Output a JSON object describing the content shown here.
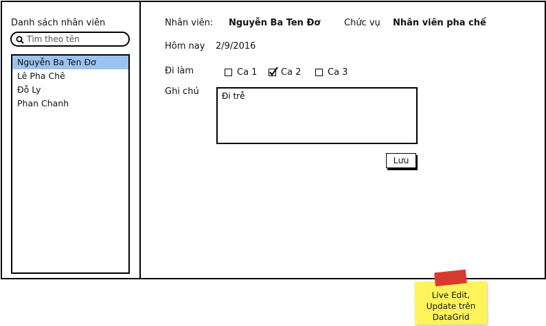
{
  "sidebar": {
    "title": "Danh sách nhân viên",
    "search_placeholder": "Tìm theo tên",
    "employees": [
      "Nguyễn Ba Ten Đơ",
      "Lê Pha Chê",
      "Đỗ Ly",
      "Phan Chanh"
    ],
    "selected_index": 0
  },
  "detail": {
    "employee_label": "Nhân viên:",
    "employee_name": "Nguyễn Ba Ten Đơ",
    "position_label": "Chức vụ",
    "position_value": "Nhân viên pha chế",
    "today_label": "Hôm nay",
    "today_value": "2/9/2016",
    "shift_label": "Đi làm",
    "shifts": [
      {
        "label": "Ca 1",
        "checked": false
      },
      {
        "label": "Ca 2",
        "checked": true
      },
      {
        "label": "Ca 3",
        "checked": false
      }
    ],
    "notes_label": "Ghi chú",
    "notes_value": "Đi trễ",
    "save_label": "Lưu"
  },
  "sticky_note": {
    "text": "Live Edit,\nUpdate trên\nDataGrid",
    "note_color": "#fff35a",
    "tape_color": "#d93a30"
  },
  "colors": {
    "selected_row": "#9cc3ef"
  }
}
